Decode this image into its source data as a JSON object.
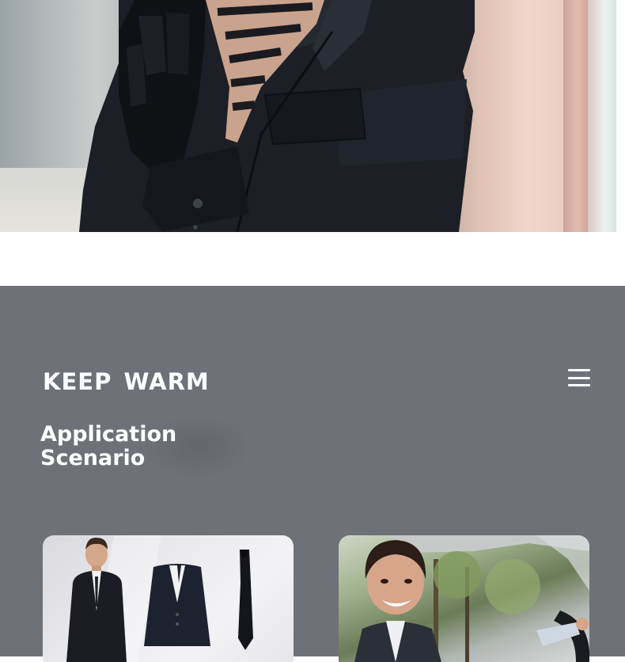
{
  "hero": {
    "image": "man-in-black-coat-with-leather-gloves-and-patterned-scarf"
  },
  "panel": {
    "brand": "KEEP  WARM",
    "section_title_line1": "Application",
    "section_title_line2": "Scenario",
    "menu_icon": "hamburger-menu-icon",
    "background_color": "#6e7178"
  },
  "cards": [
    {
      "image": "business-suit-jacket-and-tie"
    },
    {
      "image": "smiling-man-driving-car"
    }
  ]
}
